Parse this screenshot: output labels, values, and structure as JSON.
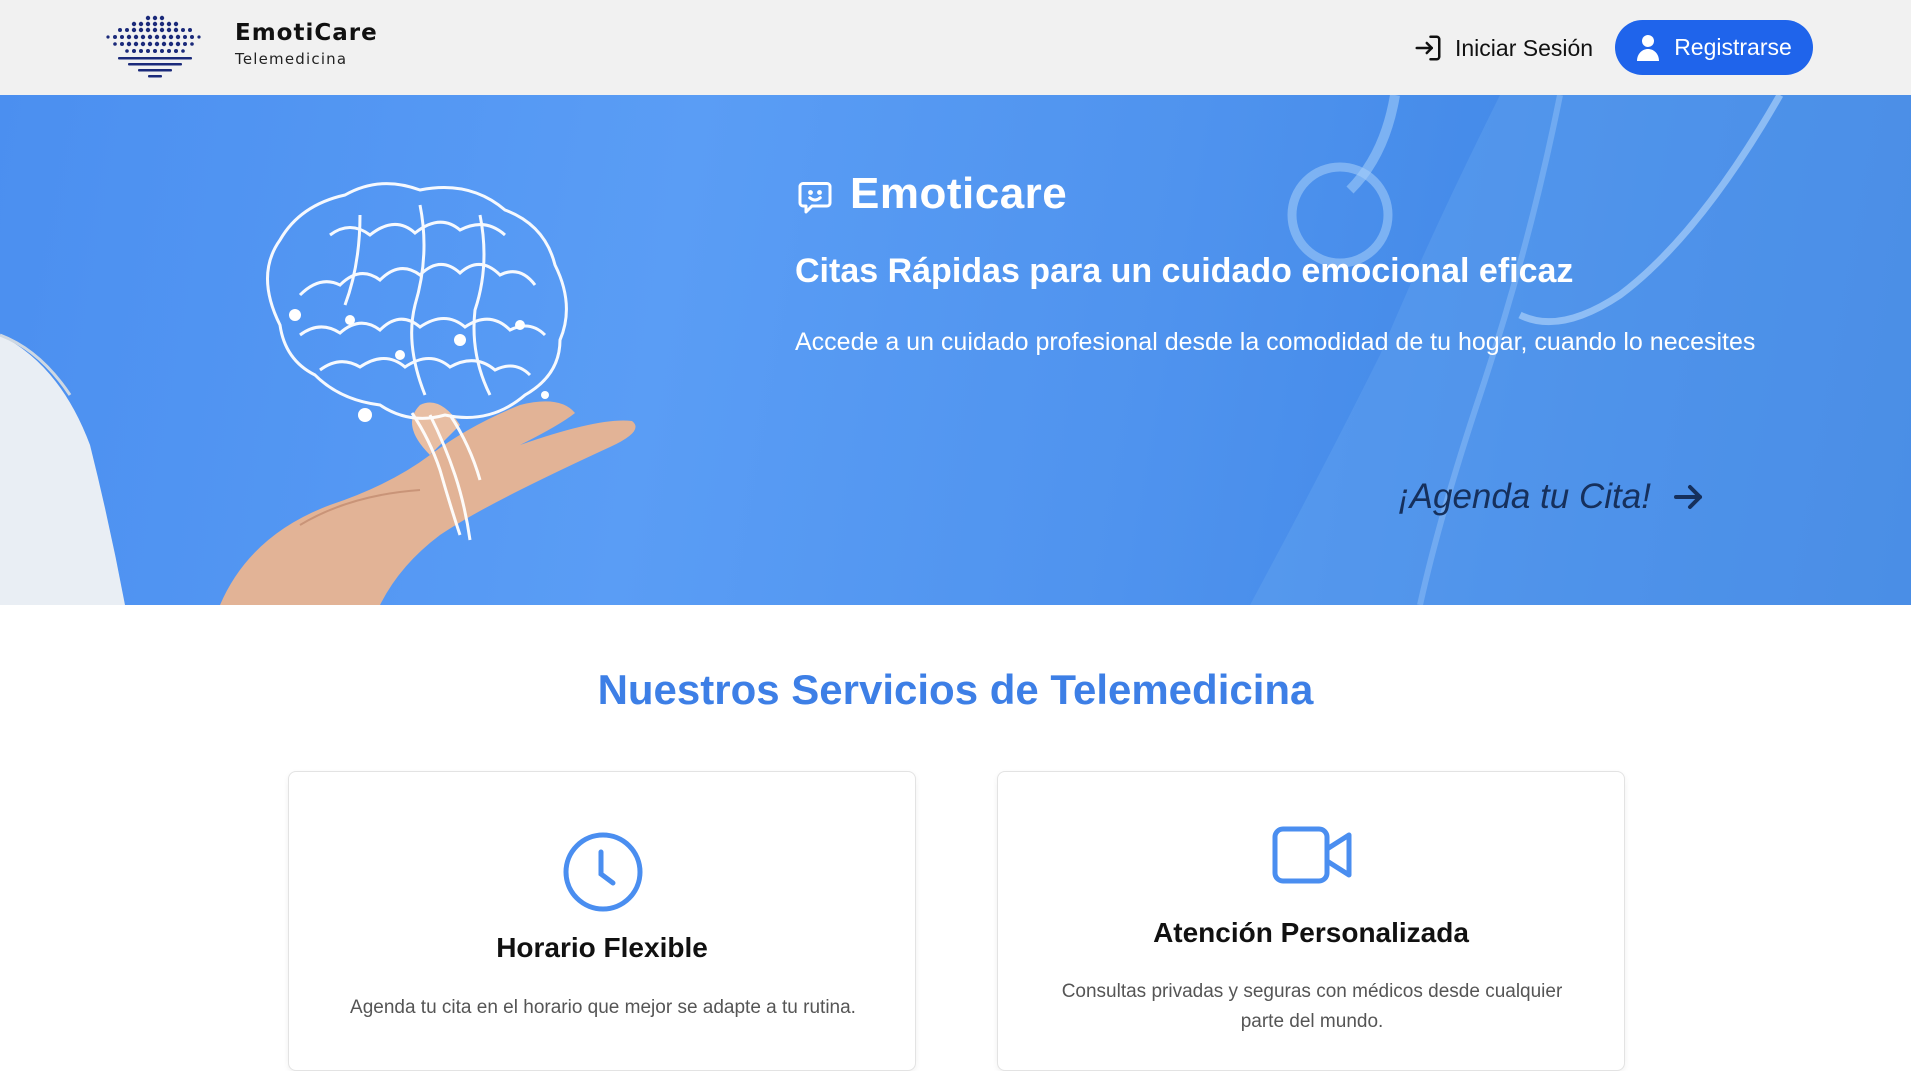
{
  "header": {
    "brand_name": "EmotiCare",
    "brand_subtitle": "Telemedicina",
    "login_label": "Iniciar Sesión",
    "register_label": "Registrarse",
    "login_icon": "login-icon",
    "register_icon": "user-icon"
  },
  "hero": {
    "title": "Emoticare",
    "subtitle": "Citas Rápidas para un cuidado emocional eficaz",
    "description": "Accede a un cuidado profesional desde la comodidad de tu hogar, cuando lo necesites",
    "cta_label": "¡Agenda tu Cita!",
    "title_icon": "chat-smile-icon",
    "cta_icon": "arrow-right-icon"
  },
  "services": {
    "title": "Nuestros Servicios de Telemedicina",
    "cards": [
      {
        "icon": "clock-icon",
        "title": "Horario Flexible",
        "text": "Agenda tu cita en el horario que mejor se adapte a tu rutina."
      },
      {
        "icon": "video-camera-icon",
        "title": "Atención Personalizada",
        "text": "Consultas privadas y seguras con médicos desde cualquier parte del mundo."
      }
    ]
  },
  "colors": {
    "accent": "#1f64eb",
    "hero_blue": "#4f93ee",
    "section_title": "#3d7fe6",
    "cta_text": "#16305c",
    "logo_navy": "#1b2a7a"
  }
}
